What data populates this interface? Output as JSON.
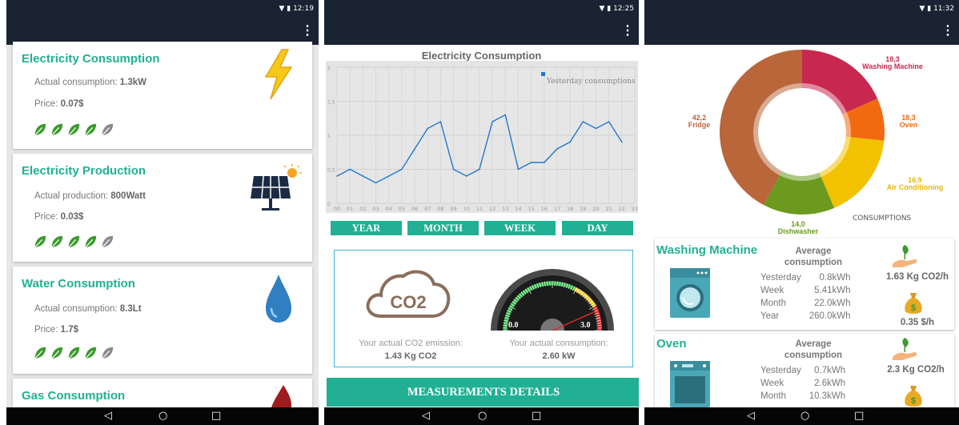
{
  "status": {
    "p1_time": "12:19",
    "p2_time": "12:25",
    "p3_time": "11:32"
  },
  "nav": {
    "back": "◁",
    "home": "○",
    "recent": "□"
  },
  "menu_glyph": "⋮",
  "panel1": {
    "cards": [
      {
        "title": "Electricity Consumption",
        "line1_label": "Actual consumption:",
        "line1_value": "1.3kW",
        "line2_label": "Price:",
        "line2_value": "0.07$",
        "icon": "lightning-icon",
        "rating": 4
      },
      {
        "title": "Electricity Production",
        "line1_label": "Actual production:",
        "line1_value": "800Watt",
        "line2_label": "Price:",
        "line2_value": "0.03$",
        "icon": "solar-panel-icon",
        "rating": 4
      },
      {
        "title": "Water Consumption",
        "line1_label": "Actual consumption:",
        "line1_value": "8.3Lt",
        "line2_label": "Price:",
        "line2_value": "1.7$",
        "icon": "water-drop-icon",
        "rating": 4
      },
      {
        "title": "Gas Consumption",
        "icon": "flame-icon"
      }
    ]
  },
  "panel2": {
    "chart_title": "Electricity Consumption",
    "tabs": [
      "YEAR",
      "MONTH",
      "WEEK",
      "DAY"
    ],
    "co2_icon_text": "CO2",
    "co2_label": "Your actual CO2 emission:",
    "co2_value": "1.43 Kg CO2",
    "cons_label": "Your actual consumption:",
    "cons_value": "2.60 kW",
    "gauge_min": "0.0",
    "gauge_max": "3.0",
    "gauge_value": 2.6,
    "measurements_button": "MEASUREMENTS DETAILS"
  },
  "chart_data": {
    "type": "line",
    "title": "Electricity Consumption",
    "xlabel": "",
    "ylabel": "",
    "ylim": [
      0,
      2
    ],
    "y_ticks": [
      "0",
      "0,5",
      "1",
      "1,5",
      "2"
    ],
    "categories": [
      "00",
      "01",
      "02",
      "03",
      "04",
      "05",
      "06",
      "07",
      "08",
      "09",
      "10",
      "11",
      "12",
      "13",
      "14",
      "15",
      "16",
      "17",
      "18",
      "19",
      "20",
      "21",
      "22",
      "23"
    ],
    "series": [
      {
        "name": "Yesterday consumptions",
        "color": "#1f77d0",
        "values": [
          0.4,
          0.5,
          0.4,
          0.3,
          0.4,
          0.5,
          0.8,
          1.1,
          1.2,
          0.5,
          0.4,
          0.5,
          1.2,
          1.3,
          0.5,
          0.6,
          0.6,
          0.8,
          0.9,
          1.2,
          1.1,
          1.2,
          0.9
        ]
      }
    ],
    "legend": "top-right"
  },
  "panel3": {
    "donut": {
      "center_label": "CONSUMPTIONS",
      "slices": [
        {
          "name": "Washing Machine",
          "value": 18.3,
          "label_value": "18,3",
          "color": "#c8284f"
        },
        {
          "name": "Oven",
          "value": 8.3,
          "label_value": "18,3",
          "color": "#f26a10"
        },
        {
          "name": "Air Conditioning",
          "value": 16.9,
          "label_value": "16,9",
          "color": "#f2c200"
        },
        {
          "name": "Dishwasher",
          "value": 14.0,
          "label_value": "14,0",
          "color": "#6b9a1f"
        },
        {
          "name": "Fridge",
          "value": 42.2,
          "label_value": "42,2",
          "color": "#b8663a"
        }
      ]
    },
    "appliances": [
      {
        "name": "Washing Machine",
        "avg_title": "Average consumption",
        "rows": [
          [
            "Yesterday",
            "0.8kWh"
          ],
          [
            "Week",
            "5.41kWh"
          ],
          [
            "Month",
            "22.0kWh"
          ],
          [
            "Year",
            "260.0kWh"
          ]
        ],
        "co2": "1.63 Kg CO2/h",
        "price": "0.35 $/h"
      },
      {
        "name": "Oven",
        "avg_title": "Average consumption",
        "rows": [
          [
            "Yesterday",
            "0.7kWh"
          ],
          [
            "Week",
            "2.6kWh"
          ],
          [
            "Month",
            "10.3kWh"
          ]
        ],
        "co2": "2.3 Kg CO2/h"
      }
    ]
  },
  "colors": {
    "accent": "#21b093",
    "appbar": "#1a2332",
    "leaf_on": "#3b9a2c",
    "leaf_off": "#8a8a8a"
  }
}
